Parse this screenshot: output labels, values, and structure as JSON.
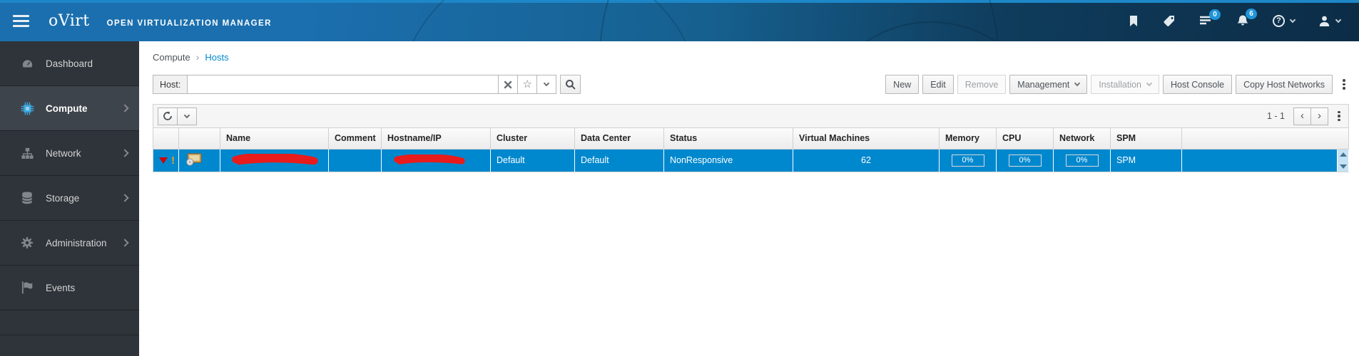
{
  "masthead": {
    "product": "oVirt",
    "subtitle": "OPEN VIRTUALIZATION MANAGER",
    "tasks_badge": "0",
    "alerts_badge": "6",
    "help_glyph": "?"
  },
  "sidebar": {
    "items": [
      {
        "label": "Dashboard",
        "icon": "dashboard-icon",
        "active": false,
        "has_submenu": false
      },
      {
        "label": "Compute",
        "icon": "cpu-icon",
        "active": true,
        "has_submenu": true
      },
      {
        "label": "Network",
        "icon": "sitemap-icon",
        "active": false,
        "has_submenu": true
      },
      {
        "label": "Storage",
        "icon": "database-icon",
        "active": false,
        "has_submenu": true
      },
      {
        "label": "Administration",
        "icon": "gear-icon",
        "active": false,
        "has_submenu": true
      },
      {
        "label": "Events",
        "icon": "flag-icon",
        "active": false,
        "has_submenu": false
      }
    ]
  },
  "breadcrumb": {
    "parent": "Compute",
    "separator": "›",
    "current": "Hosts"
  },
  "search": {
    "label": "Host:",
    "value": ""
  },
  "actions": {
    "buttons": [
      {
        "label": "New",
        "disabled": false
      },
      {
        "label": "Edit",
        "disabled": false
      },
      {
        "label": "Remove",
        "disabled": true
      },
      {
        "label": "Management",
        "disabled": false
      },
      {
        "label": "Installation",
        "disabled": true
      },
      {
        "label": "Host Console",
        "disabled": false
      },
      {
        "label": "Copy Host Networks",
        "disabled": false
      }
    ]
  },
  "pagination": {
    "range": "1 - 1",
    "prev": "‹",
    "next": "›"
  },
  "table": {
    "columns": [
      "",
      "",
      "Name",
      "Comment",
      "Hostname/IP",
      "Cluster",
      "Data Center",
      "Status",
      "Virtual Machines",
      "Memory",
      "CPU",
      "Network",
      "SPM",
      ""
    ],
    "row": {
      "name_redacted": true,
      "comment": "",
      "hostname_redacted": true,
      "cluster": "Default",
      "data_center": "Default",
      "status": "NonResponsive",
      "virtual_machines": "62",
      "memory": "0%",
      "cpu": "0%",
      "network": "0%",
      "spm": "SPM"
    }
  },
  "colors": {
    "selected_row": "#0088ce",
    "link": "#0088ce",
    "masthead_left": "#1b6fae",
    "masthead_right": "#0c2c46",
    "masthead_strip": "#1d87c8",
    "badge": "#2095d9",
    "sidebar_bg": "#2f343a",
    "sidebar_active": "#3e444b",
    "error_triangle": "#cf0000",
    "warning_excl": "#f0a11c",
    "redaction_scribble": "#e81c1c"
  }
}
